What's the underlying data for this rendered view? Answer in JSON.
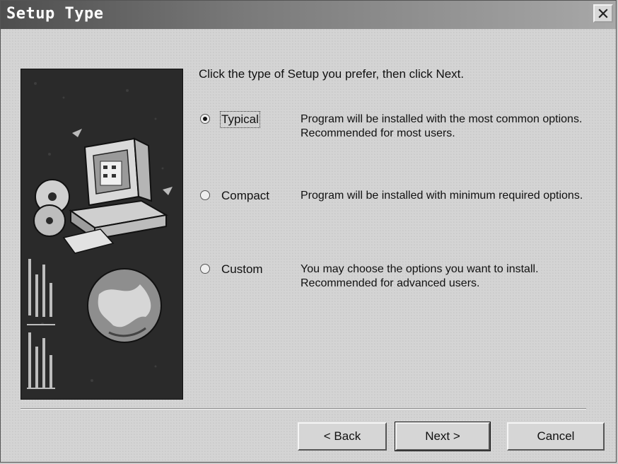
{
  "window": {
    "title": "Setup Type"
  },
  "instruction": "Click the type of Setup you prefer, then click Next.",
  "options": [
    {
      "label": "Typical",
      "selected": true,
      "description": "Program will be installed with the most common options.  Recommended for most users."
    },
    {
      "label": "Compact",
      "selected": false,
      "description": "Program will be installed with minimum required options."
    },
    {
      "label": "Custom",
      "selected": false,
      "description": "You may choose the options you want to install. Recommended for advanced users."
    }
  ],
  "buttons": {
    "back": "< Back",
    "next": "Next >",
    "cancel": "Cancel"
  },
  "icons": {
    "close": "close-icon",
    "side_image": "setup-computer-illustration"
  },
  "colors": {
    "titlebar_dark": "#4e4e4e",
    "titlebar_light": "#a8a8a8",
    "dialog_bg": "#d4d4d4"
  }
}
